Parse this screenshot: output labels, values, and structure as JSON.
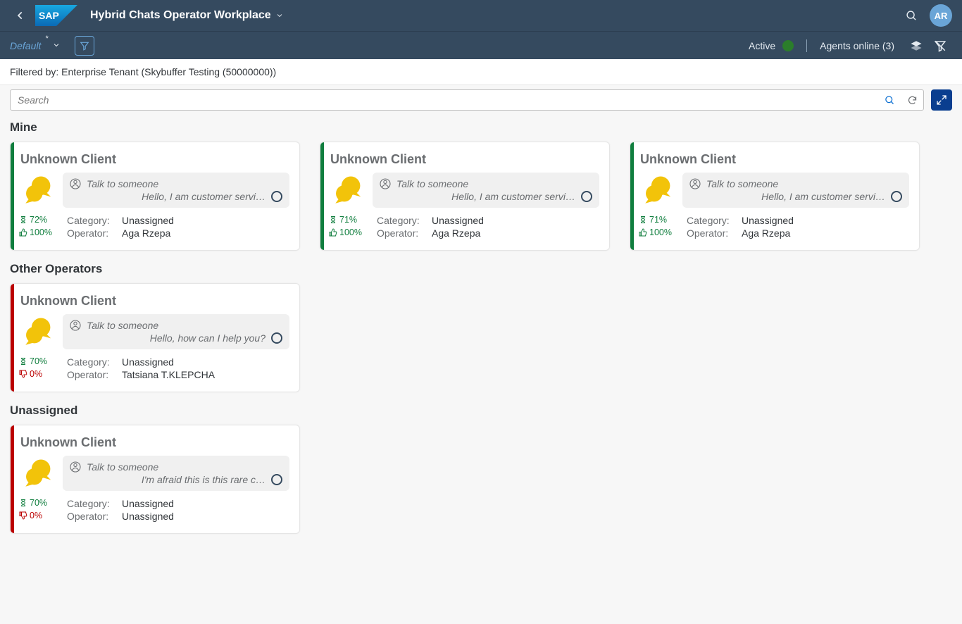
{
  "shellbar": {
    "title": "Hybrid Chats Operator Workplace",
    "avatar": "AR"
  },
  "toolbar2": {
    "variant": "Default",
    "active": "Active",
    "agents_online": "Agents online (3)"
  },
  "filterinfo": "Filtered by: Enterprise Tenant (Skybuffer Testing (50000000))",
  "search": {
    "placeholder": "Search"
  },
  "sections": {
    "mine": {
      "title": "Mine",
      "cards": [
        {
          "client": "Unknown Client",
          "talk": "Talk to someone",
          "preview": "Hello, I am customer servi…",
          "timer": "72%",
          "thumbs": "100%",
          "thumbs_pos": true,
          "category": "Unassigned",
          "operator": "Aga Rzepa",
          "stripe": "green"
        },
        {
          "client": "Unknown Client",
          "talk": "Talk to someone",
          "preview": "Hello, I am customer servi…",
          "timer": "71%",
          "thumbs": "100%",
          "thumbs_pos": true,
          "category": "Unassigned",
          "operator": "Aga Rzepa",
          "stripe": "green"
        },
        {
          "client": "Unknown Client",
          "talk": "Talk to someone",
          "preview": "Hello, I am customer servi…",
          "timer": "71%",
          "thumbs": "100%",
          "thumbs_pos": true,
          "category": "Unassigned",
          "operator": "Aga Rzepa",
          "stripe": "green"
        }
      ]
    },
    "other": {
      "title": "Other Operators",
      "cards": [
        {
          "client": "Unknown Client",
          "talk": "Talk to someone",
          "preview": "Hello, how can I help you?",
          "timer": "70%",
          "thumbs": "0%",
          "thumbs_pos": false,
          "category": "Unassigned",
          "operator": "Tatsiana T.KLEPCHA",
          "stripe": "red"
        }
      ]
    },
    "unassigned": {
      "title": "Unassigned",
      "cards": [
        {
          "client": "Unknown Client",
          "talk": "Talk to someone",
          "preview": "I'm afraid this is this rare c…",
          "timer": "70%",
          "thumbs": "0%",
          "thumbs_pos": false,
          "category": "Unassigned",
          "operator": "Unassigned",
          "stripe": "red"
        }
      ]
    }
  },
  "labels": {
    "category": "Category:",
    "operator": "Operator:"
  }
}
